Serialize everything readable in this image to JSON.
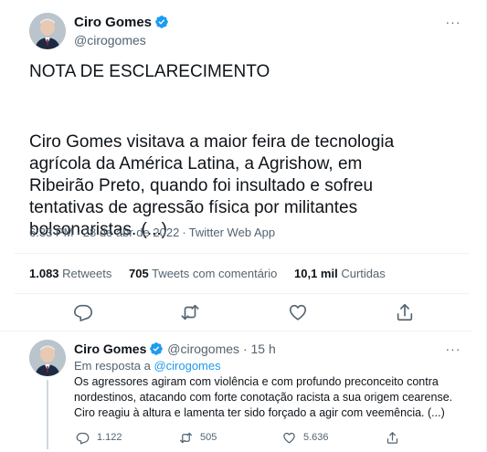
{
  "tweet": {
    "author_name": "Ciro Gomes",
    "author_handle": "@cirogomes",
    "heading": "NOTA DE ESCLARECIMENTO",
    "body": "Ciro Gomes visitava a maior feira de tecnologia agrícola da América Latina, a Agrishow, em Ribeirão Preto, quando foi insultado e sofreu tentativas de agressão física por militantes bolsonaristas. (...)",
    "time": "6:33 PM",
    "date": "28 de abr de 2022",
    "separator": "·",
    "app": "Twitter Web App",
    "stats": {
      "retweets_count": "1.083",
      "retweets_label": "Retweets",
      "quotes_count": "705",
      "quotes_label": "Tweets com comentário",
      "likes_count": "10,1 mil",
      "likes_label": "Curtidas"
    },
    "more_label": "···"
  },
  "reply": {
    "author_name": "Ciro Gomes",
    "author_handle": "@cirogomes",
    "dot": "·",
    "time": "15 h",
    "more_label": "···",
    "in_reply_prefix": "Em resposta a",
    "in_reply_handle": "@cirogomes",
    "text_lines": [
      "Os agressores agiram com violência e com profundo preconceito contra",
      "nordestinos, atacando com forte conotação racista a sua origem cearense.",
      "Ciro reagiu à altura e lamenta ter sido forçado a agir com veemência. (...)"
    ],
    "replies_count": "1.122",
    "retweets_count": "505",
    "likes_count": "5.636"
  },
  "colors": {
    "text_primary": "#0f1419",
    "text_secondary": "#536471",
    "link": "#1d9bf0",
    "verified": "#1d9bf0",
    "divider": "#eff3f4"
  },
  "icons": {
    "verified": "verified-badge-icon",
    "more": "more-dots-icon",
    "reply": "reply-icon",
    "retweet": "retweet-icon",
    "like": "heart-icon",
    "share": "share-icon"
  }
}
